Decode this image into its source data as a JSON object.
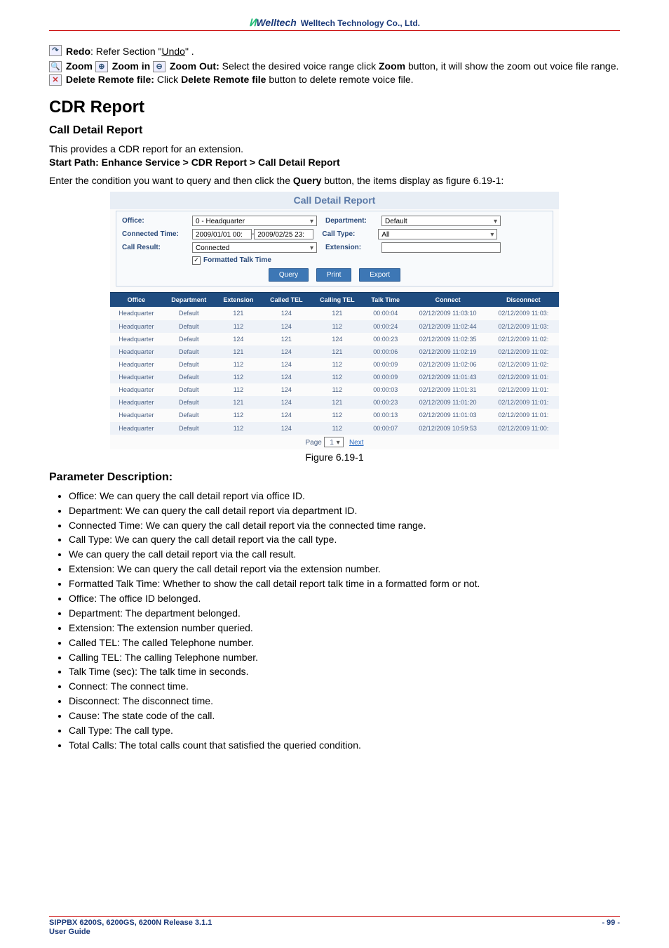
{
  "header": {
    "logo_main": "Welltech",
    "company": "Welltech Technology Co., Ltd."
  },
  "instructions": {
    "redo_label": "Redo",
    "redo_text": ": Refer Section \"",
    "redo_link": "Undo",
    "redo_tail": "\" .",
    "zoom": {
      "l1": "Zoom",
      "l2": "Zoom in",
      "l3": "Zoom Out:",
      "tail": " Select the desired voice range click ",
      "line2a": "Zoom",
      "line2b": " button, it will show the zoom out voice file range."
    },
    "delete": {
      "l1": "Delete Remote file:",
      "mid": " Click ",
      "l2": "Delete Remote file",
      "tail": " button to delete remote voice file."
    }
  },
  "heading": "CDR Report",
  "subheading": "Call Detail Report",
  "intro1": "This provides a CDR report for an extension.",
  "intro2": "Start Path: Enhance Service > CDR Report > Call Detail Report",
  "intro3a": "Enter the condition you want to query and then click the ",
  "intro3b": "Query",
  "intro3c": " button, the items display as figure 6.19-1:",
  "shot": {
    "title": "Call Detail Report",
    "office_label": "Office:",
    "office_value": "0 - Headquarter",
    "dept_label": "Department:",
    "dept_value": "Default",
    "conn_time_label": "Connected Time:",
    "conn_time_from": "2009/01/01 00:",
    "conn_time_sep": " - ",
    "conn_time_to": "2009/02/25 23:",
    "call_type_label": "Call Type:",
    "call_type_value": "All",
    "call_result_label": "Call Result:",
    "call_result_value": "Connected",
    "ext_label": "Extension:",
    "ext_value": "",
    "format_chk_label": "Formatted Talk Time",
    "btn_query": "Query",
    "btn_print": "Print",
    "btn_export": "Export",
    "table_headers": [
      "Office",
      "Department",
      "Extension",
      "Called TEL",
      "Calling TEL",
      "Talk Time",
      "Connect",
      "Disconnect"
    ],
    "rows": [
      [
        "Headquarter",
        "Default",
        "121",
        "124",
        "121",
        "00:00:04",
        "02/12/2009 11:03:10",
        "02/12/2009 11:03:"
      ],
      [
        "Headquarter",
        "Default",
        "112",
        "124",
        "112",
        "00:00:24",
        "02/12/2009 11:02:44",
        "02/12/2009 11:03:"
      ],
      [
        "Headquarter",
        "Default",
        "124",
        "121",
        "124",
        "00:00:23",
        "02/12/2009 11:02:35",
        "02/12/2009 11:02:"
      ],
      [
        "Headquarter",
        "Default",
        "121",
        "124",
        "121",
        "00:00:06",
        "02/12/2009 11:02:19",
        "02/12/2009 11:02:"
      ],
      [
        "Headquarter",
        "Default",
        "112",
        "124",
        "112",
        "00:00:09",
        "02/12/2009 11:02:06",
        "02/12/2009 11:02:"
      ],
      [
        "Headquarter",
        "Default",
        "112",
        "124",
        "112",
        "00:00:09",
        "02/12/2009 11:01:43",
        "02/12/2009 11:01:"
      ],
      [
        "Headquarter",
        "Default",
        "112",
        "124",
        "112",
        "00:00:03",
        "02/12/2009 11:01:31",
        "02/12/2009 11:01:"
      ],
      [
        "Headquarter",
        "Default",
        "121",
        "124",
        "121",
        "00:00:23",
        "02/12/2009 11:01:20",
        "02/12/2009 11:01:"
      ],
      [
        "Headquarter",
        "Default",
        "112",
        "124",
        "112",
        "00:00:13",
        "02/12/2009 11:01:03",
        "02/12/2009 11:01:"
      ],
      [
        "Headquarter",
        "Default",
        "112",
        "124",
        "112",
        "00:00:07",
        "02/12/2009 10:59:53",
        "02/12/2009 11:00:"
      ]
    ],
    "pager_page": "Page",
    "pager_sel": "1",
    "pager_next": "Next"
  },
  "figure_caption": "Figure 6.19-1",
  "param_head": "Parameter Description:",
  "params": [
    "Office: We can query the call detail report via office ID.",
    "Department: We can query the call detail report via department ID.",
    "Connected Time: We can query the call detail report via the connected time range.",
    "Call Type: We can query the call detail report via the call type.",
    "We can query the call detail report via the call result.",
    "Extension: We can query the call detail report via the extension number.",
    "Formatted Talk Time: Whether to show the call detail report talk time in a formatted form or not.",
    "Office: The office ID belonged.",
    "Department: The department belonged.",
    "Extension: The extension number queried.",
    "Called TEL: The called Telephone number.",
    "Calling TEL: The calling Telephone number.",
    "Talk Time (sec): The talk time in seconds.",
    "Connect: The connect time.",
    "Disconnect: The disconnect time.",
    "Cause: The state code of the call.",
    "Call Type: The call type.",
    "Total Calls: The total calls count that satisfied the queried condition."
  ],
  "footer": {
    "l1": "SIPPBX 6200S, 6200GS, 6200N Release 3.1.1",
    "l2": "User Guide",
    "page": "- 99 -"
  }
}
